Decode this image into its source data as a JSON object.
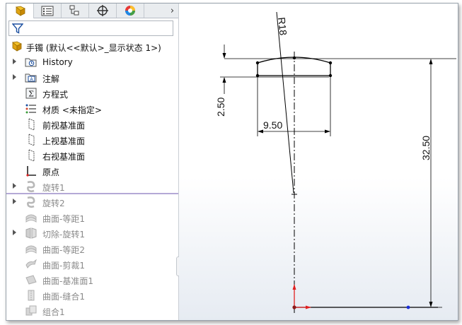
{
  "toolbar": {
    "tabs": [
      {
        "name": "feature-manager",
        "icon": "feature-tree-icon",
        "active": true
      },
      {
        "name": "property-manager",
        "icon": "property-list-icon",
        "active": false
      },
      {
        "name": "configuration-manager",
        "icon": "configuration-icon",
        "active": false
      },
      {
        "name": "dimxpert-manager",
        "icon": "crosshair-icon",
        "active": false
      },
      {
        "name": "display-manager",
        "icon": "color-ball-icon",
        "active": false
      }
    ],
    "more_label": "›"
  },
  "filter": {
    "icon": "filter-icon"
  },
  "tree": {
    "root": {
      "label": "手镯  (默认<<默认>_显示状态 1>)",
      "icon": "part-icon"
    },
    "items": [
      {
        "label": "History",
        "icon": "history-icon",
        "expandable": true,
        "dimmed": false
      },
      {
        "label": "注解",
        "icon": "annotation-icon",
        "expandable": true,
        "dimmed": false
      },
      {
        "label": "方程式",
        "icon": "equation-icon",
        "expandable": false,
        "dimmed": false
      },
      {
        "label": "材质 <未指定>",
        "icon": "material-icon",
        "expandable": false,
        "dimmed": false
      },
      {
        "label": "前视基准面",
        "icon": "plane-icon",
        "expandable": false,
        "dimmed": false
      },
      {
        "label": "上视基准面",
        "icon": "plane-icon",
        "expandable": false,
        "dimmed": false
      },
      {
        "label": "右视基准面",
        "icon": "plane-icon",
        "expandable": false,
        "dimmed": false
      },
      {
        "label": "原点",
        "icon": "origin-icon",
        "expandable": false,
        "dimmed": false
      },
      {
        "label": "旋转1",
        "icon": "revolve-icon",
        "expandable": true,
        "dimmed": true
      },
      {
        "label": "旋转2",
        "icon": "revolve-icon",
        "expandable": true,
        "dimmed": true
      },
      {
        "label": "曲面-等距1",
        "icon": "surface-offset-icon",
        "expandable": false,
        "dimmed": true
      },
      {
        "label": "切除-旋转1",
        "icon": "cut-revolve-icon",
        "expandable": true,
        "dimmed": true
      },
      {
        "label": "曲面-等距2",
        "icon": "surface-offset-icon",
        "expandable": false,
        "dimmed": true
      },
      {
        "label": "曲面-剪裁1",
        "icon": "surface-trim-icon",
        "expandable": false,
        "dimmed": true
      },
      {
        "label": "曲面-基准面1",
        "icon": "surface-plane-icon",
        "expandable": false,
        "dimmed": true
      },
      {
        "label": "曲面-缝合1",
        "icon": "surface-knit-icon",
        "expandable": false,
        "dimmed": true
      },
      {
        "label": "组合1",
        "icon": "combine-icon",
        "expandable": false,
        "dimmed": true
      }
    ]
  },
  "sketch": {
    "dimensions": {
      "radius": "R18",
      "height_small": "2.50",
      "width": "9.50",
      "height_total": "32.50"
    },
    "colors": {
      "axis_x": "#e02020",
      "axis_y": "#e02020",
      "point": "#1a2ed8",
      "geometry": "#000000"
    }
  }
}
